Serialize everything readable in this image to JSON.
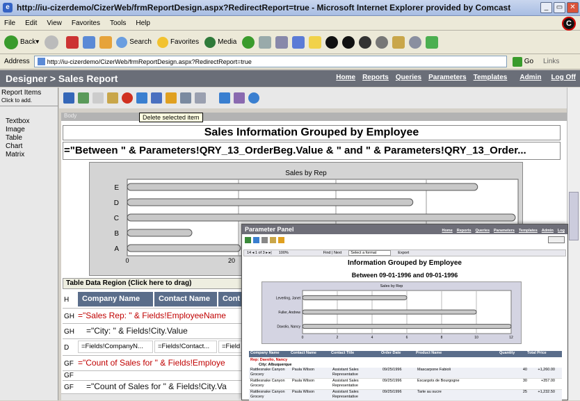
{
  "browser": {
    "title": "http://iu-cizerdemo/CizerWeb/frmReportDesign.aspx?RedirectReport=true - Microsoft Internet Explorer provided by Comcast",
    "menu": [
      "File",
      "Edit",
      "View",
      "Favorites",
      "Tools",
      "Help"
    ],
    "toolbar": {
      "back": "Back",
      "search": "Search",
      "favorites": "Favorites",
      "media": "Media"
    },
    "address_label": "Address",
    "address_value": "http://iu-cizerdemo/CizerWeb/frmReportDesign.aspx?RedirectReport=true",
    "go": "Go",
    "links": "Links"
  },
  "app": {
    "title": "Designer > Sales Report",
    "nav": [
      "Home",
      "Reports",
      "Queries",
      "Parameters",
      "Templates",
      "Admin",
      "Log Off"
    ]
  },
  "left_panel": {
    "header": "Report Items",
    "hint": "Click to add.",
    "items": [
      "Textbox",
      "Image",
      "Table",
      "Chart",
      "Matrix"
    ]
  },
  "designer": {
    "tooltip": "Delete selected item",
    "body_label": "Body",
    "report_title": "Sales Information Grouped by Employee",
    "param_expr": "=\"Between \" & Parameters!QRY_13_OrderBeg.Value & \" and \" & Parameters!QRY_13_Order...",
    "table_region": "Table Data Region (Click here to drag)",
    "rows": {
      "h_label": "H",
      "h_cells": [
        "Company Name",
        "Contact Name",
        "Cont"
      ],
      "gh1_label": "GH",
      "gh1_expr": "=\"Sales Rep: \" & Fields!EmployeeName",
      "gh2_label": "GH",
      "gh2_expr": "=\"City: \" & Fields!City.Value",
      "d_label": "D",
      "d_cells": [
        "=Fields!CompanyN...",
        "=Fields!Contact...",
        "=Field"
      ],
      "gf1_label": "GF",
      "gf1_expr": "=\"Count of Sales for \" & Fields!Employe",
      "gf2_label": "GF",
      "gf3_label": "GF",
      "gf3_expr": "=\"Count of Sales for \" & Fields!City.Va"
    }
  },
  "chart_data": [
    {
      "type": "bar",
      "title": "Sales by Rep",
      "categories": [
        "E",
        "D",
        "C",
        "B",
        "A"
      ],
      "values": [
        65,
        53,
        72,
        12,
        21
      ],
      "xticks": [
        "0",
        "20"
      ],
      "grid": true
    },
    {
      "type": "bar",
      "title": "Sales by Rep",
      "categories": [
        "Leverling, Janet",
        "Fuller, Andrew",
        "Davolio, Nancy"
      ],
      "values": [
        6,
        10,
        12
      ],
      "xticks": [
        "0",
        "2",
        "4",
        "6",
        "8",
        "10",
        "12"
      ],
      "grid": true
    }
  ],
  "param_panel": {
    "title": "Parameter Panel",
    "nav": [
      "Home",
      "Reports",
      "Queries",
      "Parameters",
      "Templates",
      "Admin",
      "Log"
    ],
    "zoom": "100%",
    "find": "Find | Next",
    "format": "Select a format",
    "export": "Export",
    "report_title": "Information Grouped by Employee",
    "date_range": "Between 09-01-1996 and 09-01-1996",
    "table_headers": [
      "Company Name",
      "Contact Name",
      "Contact Title",
      "Order Date",
      "Product Name",
      "Quantity",
      "Total Price"
    ],
    "rep": "Rep: Davolio, Nancy",
    "city": "City: Albuquerque",
    "rows": [
      [
        "Rattlesnake Canyon Grocery",
        "Paula Wilson",
        "Assistant Sales Representative",
        "09/25/1996",
        "Mascarpone Fabioli",
        "40",
        "+1,260.00"
      ],
      [
        "Rattlesnake Canyon Grocery",
        "Paula Wilson",
        "Assistant Sales Representative",
        "09/25/1996",
        "Escargots de Bourgogne",
        "30",
        "+357.00"
      ],
      [
        "Rattlesnake Canyon Grocery",
        "Paula Wilson",
        "Assistant Sales Representative",
        "09/25/1996",
        "Tarte au sucre",
        "25",
        "+1,232.50"
      ]
    ]
  }
}
